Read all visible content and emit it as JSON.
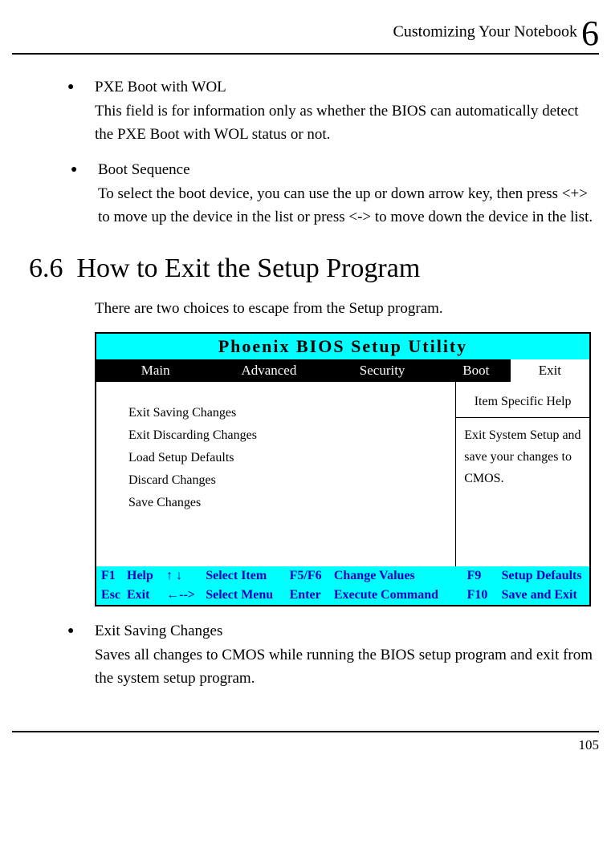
{
  "header": {
    "title": "Customizing Your Notebook ",
    "chapter_num": "6"
  },
  "bullets_top": [
    {
      "title": "PXE Boot with WOL",
      "body": "This field is for information only as whether the BIOS can automatically detect the PXE Boot with WOL status or not."
    },
    {
      "title": "Boot Sequence",
      "body": "To select the boot device, you can use the up or down arrow key, then press <+> to move up the device in the list or press <-> to move down the device in the list."
    }
  ],
  "section": {
    "number": "6.6",
    "title": "How to Exit the Setup Program"
  },
  "intro": "There are two choices to escape from the Setup program.",
  "bios": {
    "title": "Phoenix BIOS Setup Utility",
    "tabs": [
      "Main",
      "Advanced",
      "Security",
      "Boot",
      "Exit"
    ],
    "active_tab_index": 4,
    "exit_items": [
      "Exit Saving Changes",
      "Exit Discarding Changes",
      "Load Setup Defaults",
      "Discard Changes",
      "Save Changes"
    ],
    "help_header": "Item Specific Help",
    "help_body": "Exit System Setup and save your changes to CMOS.",
    "footer": [
      {
        "k1": "F1",
        "k2": "Help",
        "arr": "↑ ↓",
        "sel": "Select Item",
        "k3": "F5/F6",
        "chg": "Change Values",
        "k4": "F9",
        "cmd": "Setup Defaults"
      },
      {
        "k1": "Esc",
        "k2": "Exit",
        "arr": "←-->",
        "sel": "Select Menu",
        "k3": "Enter",
        "chg": "Execute Command",
        "k4": "F10",
        "cmd": "Save and Exit"
      }
    ]
  },
  "bullets_bottom": [
    {
      "title": "Exit Saving Changes",
      "body": "Saves all changes to CMOS while running the BIOS setup program and exit from the system setup program."
    }
  ],
  "page_number": "105"
}
